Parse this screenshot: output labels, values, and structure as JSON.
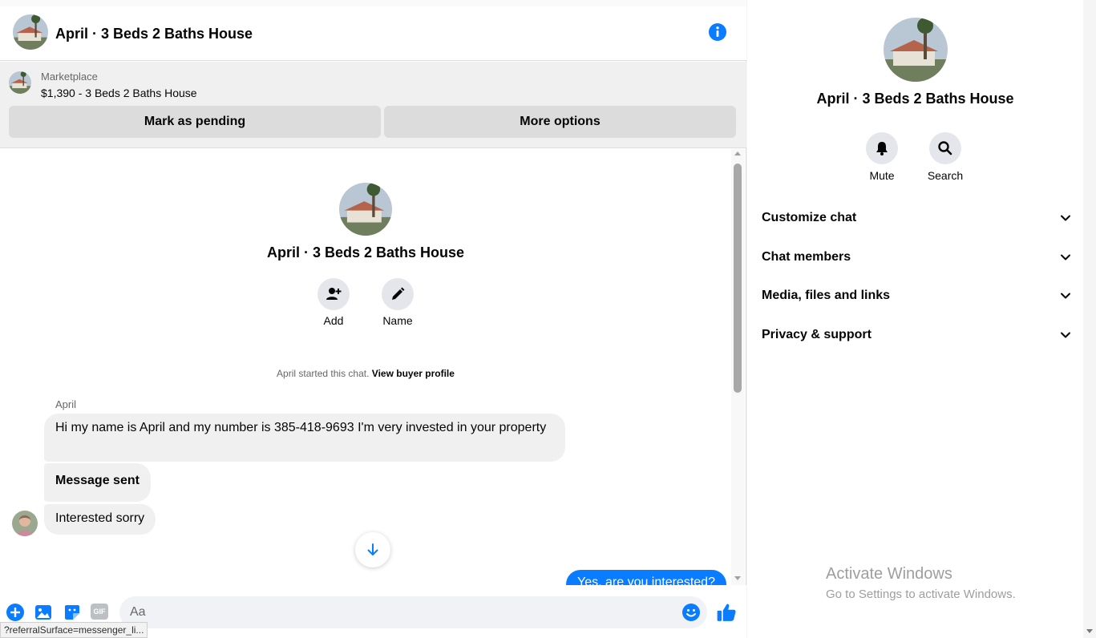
{
  "header": {
    "title": "April · 3 Beds 2 Baths House",
    "info_icon": "info-icon"
  },
  "marketplace": {
    "label": "Marketplace",
    "listing": "$1,390 - 3 Beds 2 Baths House",
    "mark_pending_label": "Mark as pending",
    "more_options_label": "More options"
  },
  "thread": {
    "title": "April · 3 Beds 2 Baths House",
    "actions": [
      {
        "label": "Add",
        "icon": "add-person-icon"
      },
      {
        "label": "Name",
        "icon": "pencil-icon"
      }
    ],
    "started_text": "April started this chat.",
    "view_profile_link": "View buyer profile",
    "sender": "April",
    "messages": [
      {
        "text": "Hi my name is April and my number is 385-418-9693 I'm very invested in your property"
      },
      {
        "text": "Message sent"
      },
      {
        "text": "Interested sorry"
      }
    ],
    "outgoing_partial": "Yes, are you interested?"
  },
  "composer": {
    "placeholder": "Aa",
    "icons": [
      "plus-icon",
      "photo-icon",
      "sticker-icon",
      "gif-icon",
      "emoji-icon",
      "like-icon"
    ],
    "gif_label": "GIF"
  },
  "status_url": "?referralSurface=messenger_li...",
  "details": {
    "title": "April · 3 Beds 2 Baths House",
    "actions": [
      {
        "label": "Mute",
        "icon": "bell-icon"
      },
      {
        "label": "Search",
        "icon": "search-icon"
      }
    ],
    "sections": [
      {
        "label": "Customize chat"
      },
      {
        "label": "Chat members"
      },
      {
        "label": "Media, files and links"
      },
      {
        "label": "Privacy & support"
      }
    ]
  },
  "watermark": {
    "line1": "Activate Windows",
    "line2": "Go to Settings to activate Windows."
  },
  "colors": {
    "accent": "#0a7cff",
    "bubble_gray": "#f0f0f0",
    "button_gray": "#dcdcdc"
  }
}
